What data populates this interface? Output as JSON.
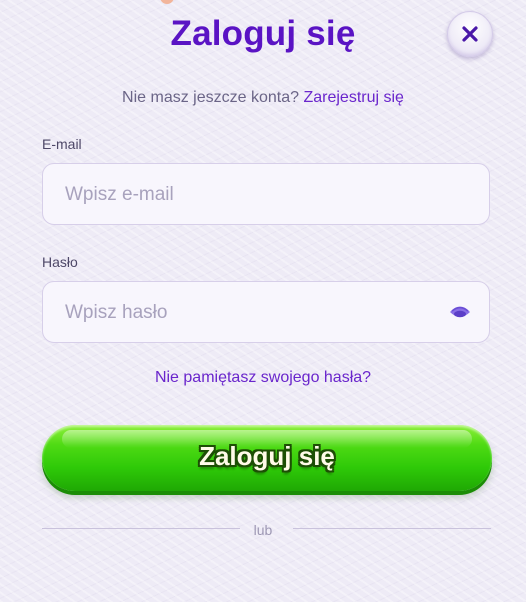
{
  "dialog": {
    "title": "Zaloguj się",
    "close_icon": "close-icon"
  },
  "register": {
    "prompt": "Nie masz jeszcze konta?",
    "link": "Zarejestruj się"
  },
  "email": {
    "label": "E-mail",
    "placeholder": "Wpisz e-mail",
    "value": ""
  },
  "password": {
    "label": "Hasło",
    "placeholder": "Wpisz hasło",
    "value": "",
    "toggle_icon": "eye-icon"
  },
  "forgot_password": "Nie pamiętasz swojego hasła?",
  "login_button": "Zaloguj się",
  "divider_text": "lub",
  "colors": {
    "accent": "#5a13c4",
    "link": "#6a26cc",
    "button_green": "#2ec908",
    "background": "#eeebf6"
  }
}
